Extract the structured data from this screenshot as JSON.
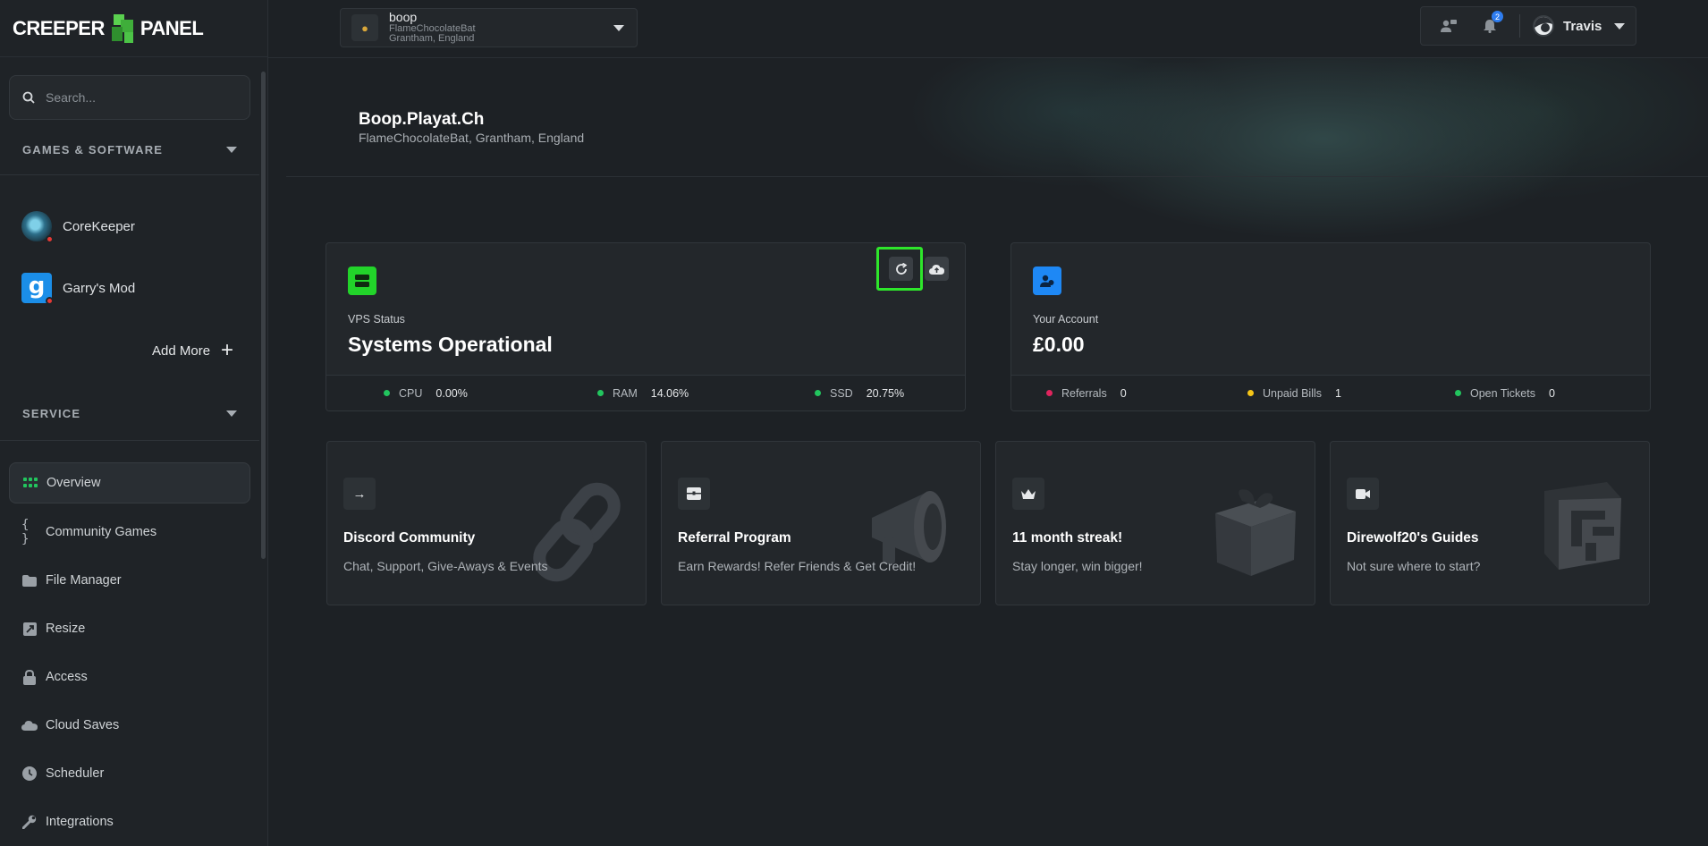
{
  "brand": {
    "logo_left": "CREEPER",
    "logo_right": "PANEL"
  },
  "search": {
    "placeholder": "Search..."
  },
  "sidebar": {
    "games_heading": "GAMES & SOFTWARE",
    "games": [
      {
        "label": "CoreKeeper"
      },
      {
        "label": "Garry's Mod",
        "icon_letter": "g"
      }
    ],
    "add_more": "Add More",
    "service_heading": "SERVICE",
    "nav": [
      {
        "label": "Overview"
      },
      {
        "label": "Community Games"
      },
      {
        "label": "File Manager"
      },
      {
        "label": "Resize"
      },
      {
        "label": "Access"
      },
      {
        "label": "Cloud Saves"
      },
      {
        "label": "Scheduler"
      },
      {
        "label": "Integrations"
      }
    ]
  },
  "server": {
    "name": "boop",
    "line1": "FlameChocolateBat",
    "line2": "Grantham, England"
  },
  "topbar": {
    "notifications_count": "2",
    "user_name": "Travis"
  },
  "hero": {
    "title": "Boop.Playat.Ch",
    "subtitle": "FlameChocolateBat, Grantham, England"
  },
  "vps": {
    "label": "VPS Status",
    "status": "Systems Operational",
    "stats": [
      {
        "name": "CPU",
        "value": "0.00%",
        "color": "#22c55e"
      },
      {
        "name": "RAM",
        "value": "14.06%",
        "color": "#22c55e"
      },
      {
        "name": "SSD",
        "value": "20.75%",
        "color": "#22c55e"
      }
    ]
  },
  "account": {
    "label": "Your Account",
    "balance": "£0.00",
    "stats": [
      {
        "name": "Referrals",
        "value": "0",
        "color": "#e0245e"
      },
      {
        "name": "Unpaid Bills",
        "value": "1",
        "color": "#f5c518"
      },
      {
        "name": "Open Tickets",
        "value": "0",
        "color": "#22c55e"
      }
    ]
  },
  "promos": [
    {
      "title": "Discord Community",
      "subtitle": "Chat, Support, Give-Aways & Events"
    },
    {
      "title": "Referral Program",
      "subtitle": "Earn Rewards! Refer Friends & Get Credit!"
    },
    {
      "title": "11 month streak!",
      "subtitle": "Stay longer, win bigger!"
    },
    {
      "title": "Direwolf20's Guides",
      "subtitle": "Not sure where to start?"
    }
  ],
  "colors": {
    "accent_green": "#22d42a",
    "accent_blue": "#1e88f5",
    "highlight": "#2ee62b"
  }
}
